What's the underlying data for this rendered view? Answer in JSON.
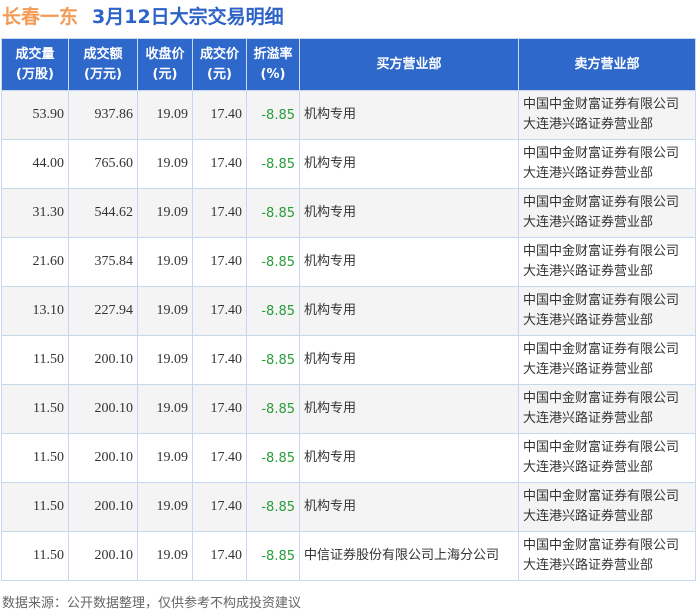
{
  "title": {
    "stock": "长春一东",
    "subtitle": "3月12日大宗交易明细"
  },
  "headers": [
    "成交量\n(万股)",
    "成交额\n(万元)",
    "收盘价\n(元)",
    "成交价\n(元)",
    "折溢率\n(%)",
    "买方营业部",
    "卖方营业部"
  ],
  "rows": [
    [
      "53.90",
      "937.86",
      "19.09",
      "17.40",
      "-8.85",
      "机构专用",
      "中国中金财富证券有限公司大连港兴路证券营业部"
    ],
    [
      "44.00",
      "765.60",
      "19.09",
      "17.40",
      "-8.85",
      "机构专用",
      "中国中金财富证券有限公司大连港兴路证券营业部"
    ],
    [
      "31.30",
      "544.62",
      "19.09",
      "17.40",
      "-8.85",
      "机构专用",
      "中国中金财富证券有限公司大连港兴路证券营业部"
    ],
    [
      "21.60",
      "375.84",
      "19.09",
      "17.40",
      "-8.85",
      "机构专用",
      "中国中金财富证券有限公司大连港兴路证券营业部"
    ],
    [
      "13.10",
      "227.94",
      "19.09",
      "17.40",
      "-8.85",
      "机构专用",
      "中国中金财富证券有限公司大连港兴路证券营业部"
    ],
    [
      "11.50",
      "200.10",
      "19.09",
      "17.40",
      "-8.85",
      "机构专用",
      "中国中金财富证券有限公司大连港兴路证券营业部"
    ],
    [
      "11.50",
      "200.10",
      "19.09",
      "17.40",
      "-8.85",
      "机构专用",
      "中国中金财富证券有限公司大连港兴路证券营业部"
    ],
    [
      "11.50",
      "200.10",
      "19.09",
      "17.40",
      "-8.85",
      "机构专用",
      "中国中金财富证券有限公司大连港兴路证券营业部"
    ],
    [
      "11.50",
      "200.10",
      "19.09",
      "17.40",
      "-8.85",
      "机构专用",
      "中国中金财富证券有限公司大连港兴路证券营业部"
    ],
    [
      "11.50",
      "200.10",
      "19.09",
      "17.40",
      "-8.85",
      "中信证券股份有限公司上海分公司",
      "中国中金财富证券有限公司大连港兴路证券营业部"
    ]
  ],
  "footer": "数据来源：公开数据整理，仅供参考不构成投资建议",
  "colors": {
    "header": "#2f68cb",
    "negative": "#2a9c3a",
    "stock": "#f39a56",
    "subtitle": "#2d62c6"
  }
}
